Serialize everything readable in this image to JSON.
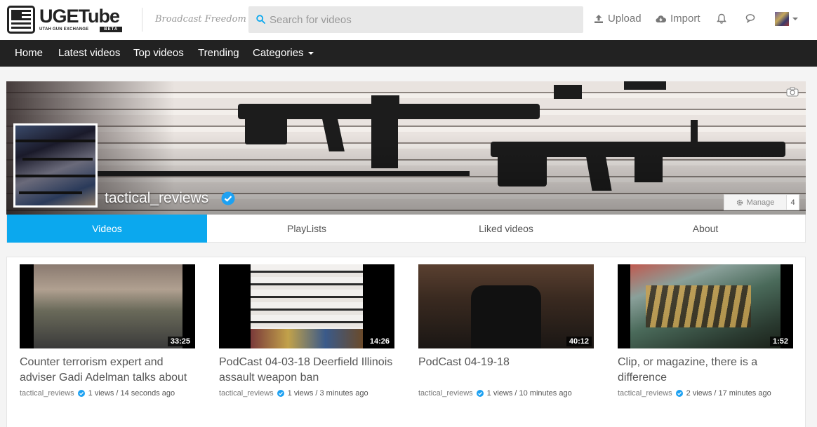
{
  "header": {
    "logo": {
      "name": "UGETube",
      "subtitle": "UTAH GUN EXCHANGE",
      "badge": "BETA"
    },
    "tagline": "Broadcast Freedom",
    "search": {
      "placeholder": "Search for videos",
      "value": ""
    },
    "upload_label": "Upload",
    "import_label": "Import",
    "icons": [
      "search-icon",
      "upload-icon",
      "cloud-icon",
      "bell-icon",
      "chat-icon",
      "chevron-down-icon"
    ]
  },
  "nav": {
    "items": [
      {
        "label": "Home"
      },
      {
        "label": "Latest videos"
      },
      {
        "label": "Top videos"
      },
      {
        "label": "Trending"
      },
      {
        "label": "Categories"
      }
    ]
  },
  "channel": {
    "name": "tactical_reviews",
    "manage_label": "Manage",
    "manage_count": "4"
  },
  "tabs": {
    "items": [
      {
        "label": "Videos",
        "active": true
      },
      {
        "label": "PlayLists",
        "active": false
      },
      {
        "label": "Liked videos",
        "active": false
      },
      {
        "label": "About",
        "active": false
      }
    ]
  },
  "videos": [
    {
      "title": "Counter terrorism expert and adviser Gadi Adelman talks about",
      "duration": "33:25",
      "owner": "tactical_reviews",
      "stats": "1 views / 14 seconds ago"
    },
    {
      "title": "PodCast 04-03-18 Deerfield Illinois assault weapon ban",
      "duration": "14:26",
      "owner": "tactical_reviews",
      "stats": "1 views / 3 minutes ago"
    },
    {
      "title": "PodCast 04-19-18",
      "duration": "40:12",
      "owner": "tactical_reviews",
      "stats": "1 views / 10 minutes ago"
    },
    {
      "title": "Clip, or magazine, there is a difference",
      "duration": "1:52",
      "owner": "tactical_reviews",
      "stats": "2 views / 17 minutes ago"
    }
  ],
  "colors": {
    "accent": "#0ba8ee",
    "nav_bg": "#222222",
    "verified": "#1da1f2"
  }
}
